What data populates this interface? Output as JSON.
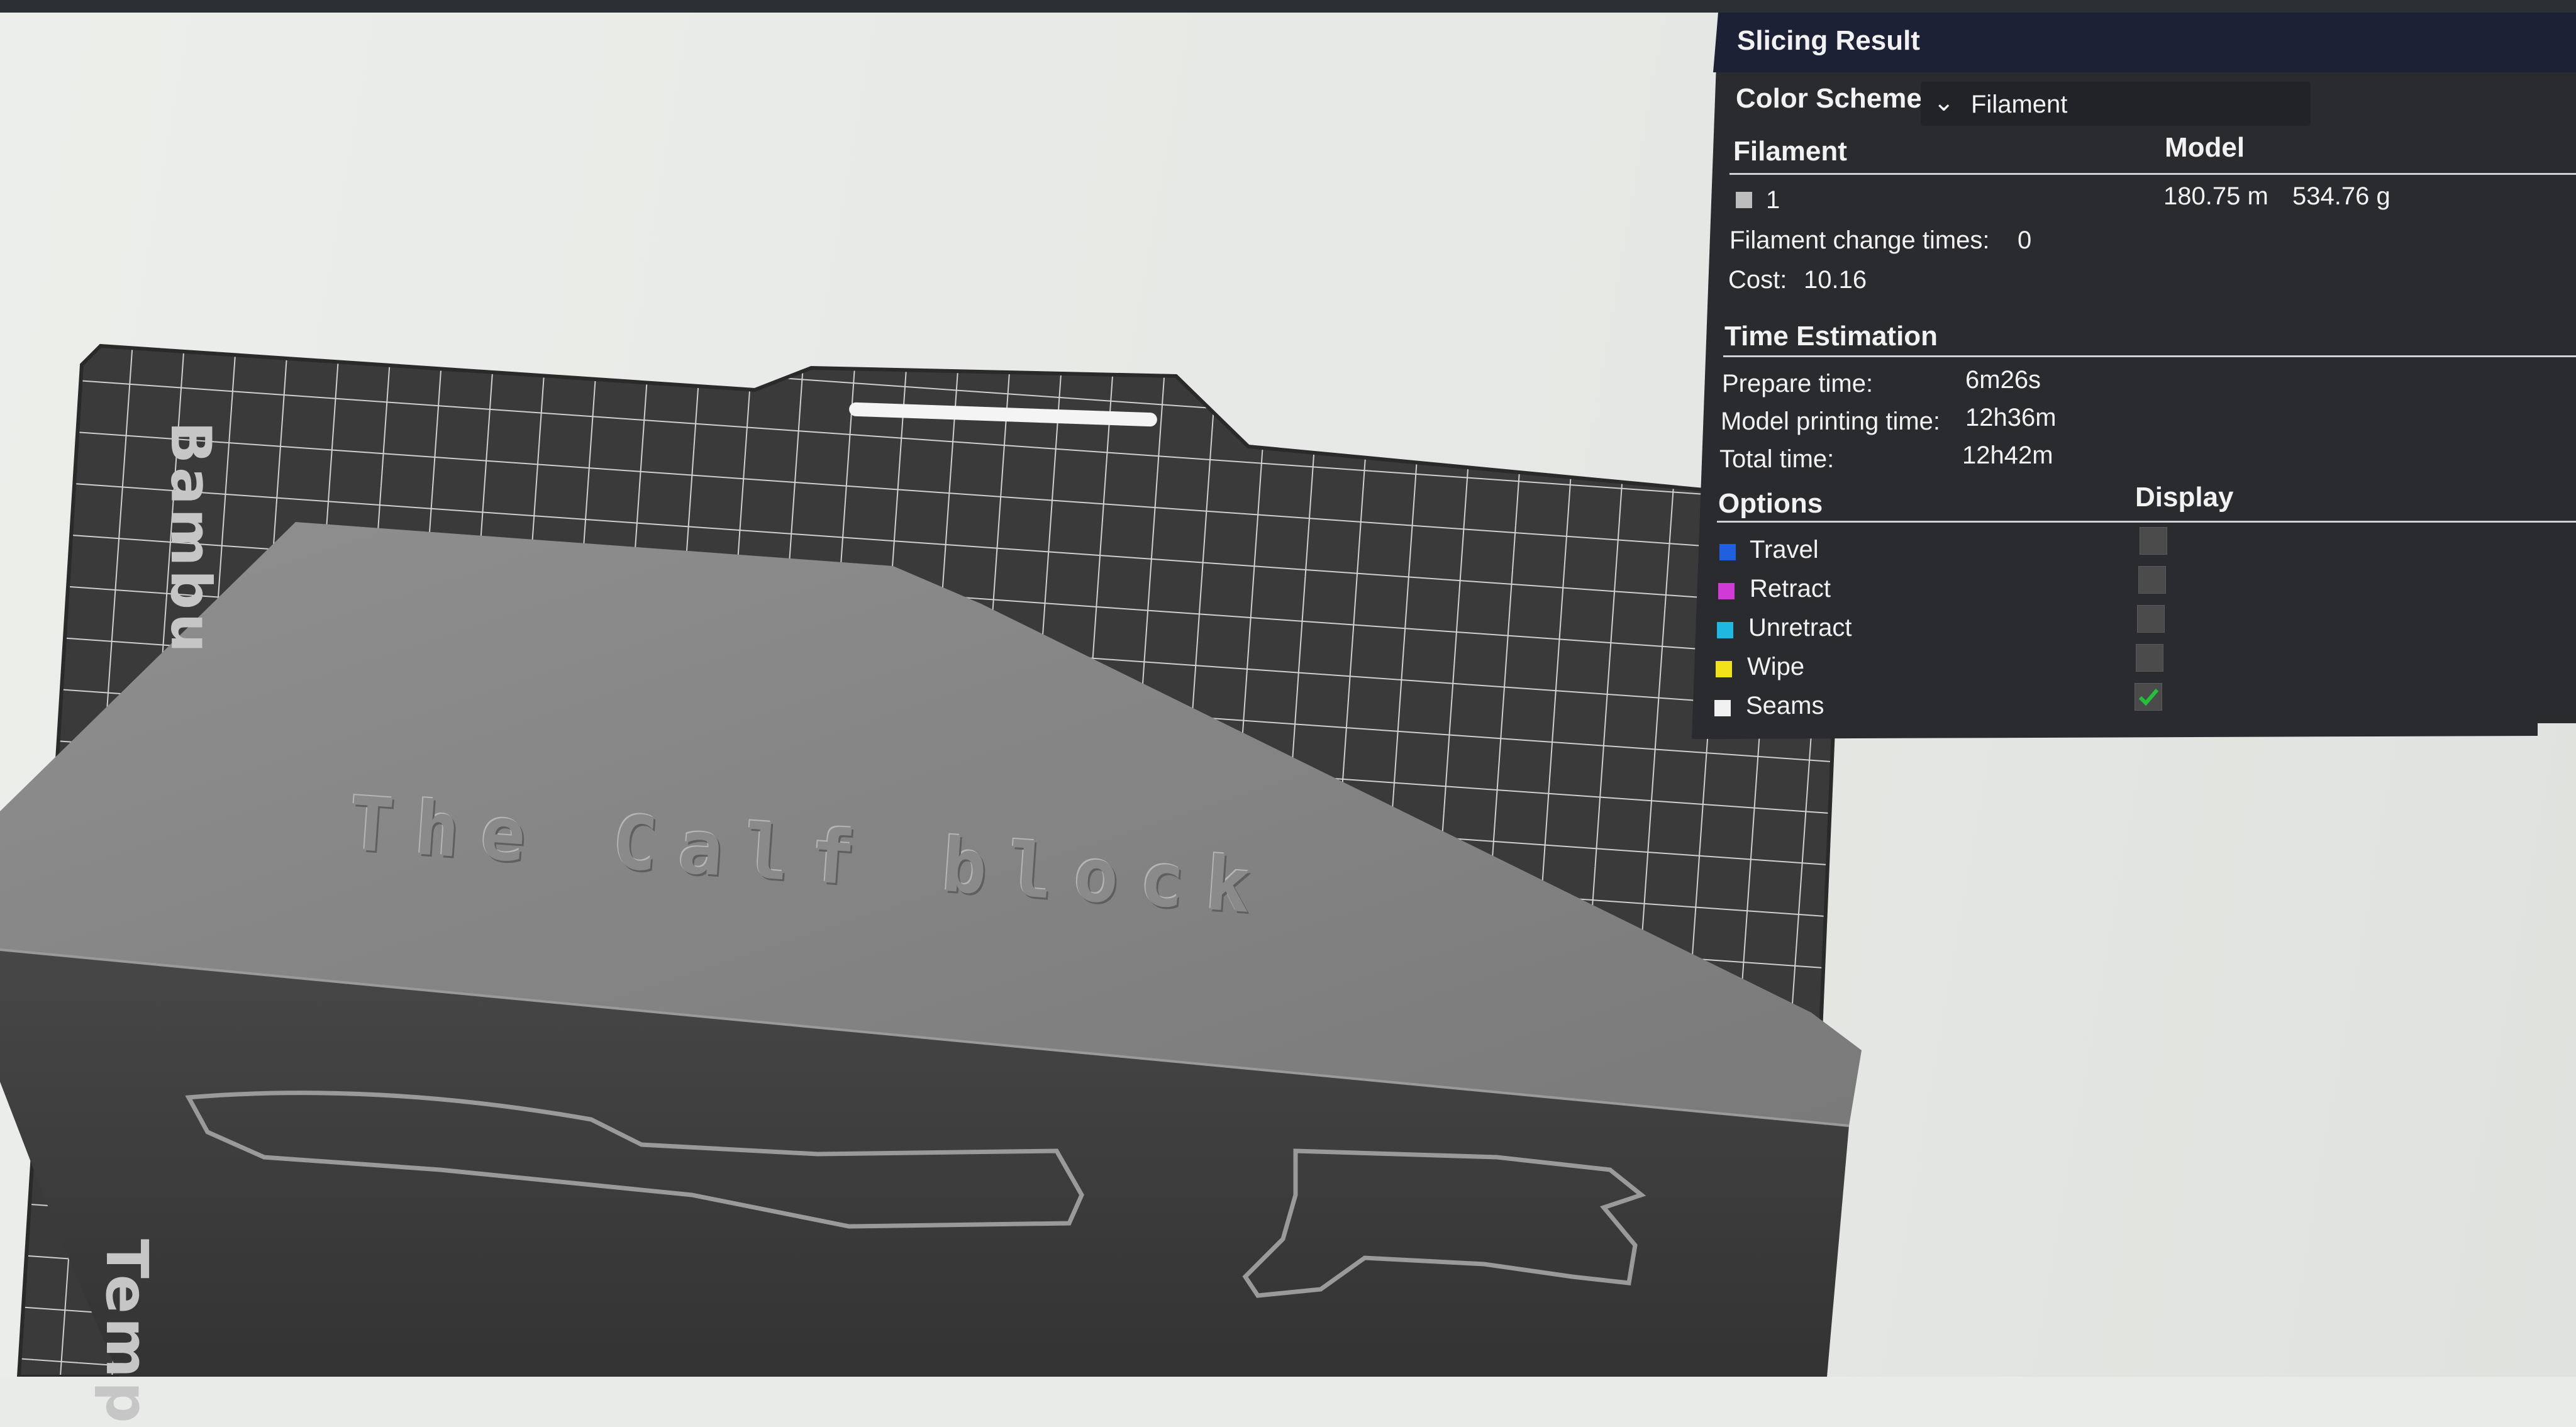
{
  "viewport": {
    "plate_brand": "Bambu",
    "plate_label": "Temp",
    "model_engraving": "The Calf block"
  },
  "panel": {
    "title": "Slicing Result",
    "color_scheme_label": "Color Scheme",
    "color_scheme_value": "Filament",
    "filament_header": "Filament",
    "model_header": "Model",
    "filament_rows": [
      {
        "id": "1",
        "length": "180.75 m",
        "weight": "534.76 g",
        "color": "#bdbdbd"
      }
    ],
    "change_times_label": "Filament change times:",
    "change_times_value": "0",
    "cost_label": "Cost:",
    "cost_value": "10.16",
    "time_header": "Time Estimation",
    "prepare_label": "Prepare time:",
    "prepare_value": "6m26s",
    "model_print_label": "Model printing time:",
    "model_print_value": "12h36m",
    "total_label": "Total time:",
    "total_value": "12h42m",
    "options_header": "Options",
    "display_header": "Display",
    "options": [
      {
        "label": "Travel",
        "color": "#1f5fe0",
        "checked": false
      },
      {
        "label": "Retract",
        "color": "#d23ad6",
        "checked": false
      },
      {
        "label": "Unretract",
        "color": "#1fb8e0",
        "checked": false
      },
      {
        "label": "Wipe",
        "color": "#f2e21a",
        "checked": false
      },
      {
        "label": "Seams",
        "color": "#f0f0f0",
        "checked": true
      }
    ]
  }
}
